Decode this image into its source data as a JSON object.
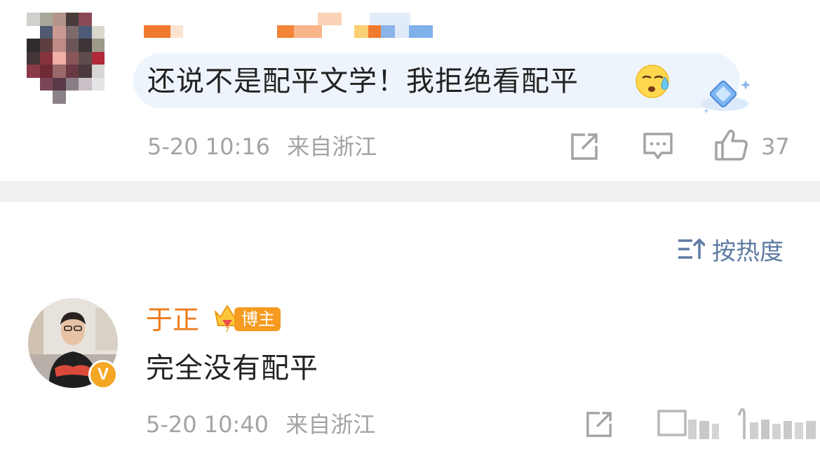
{
  "comments": [
    {
      "author": "",
      "text": "还说不是配平文学！我拒绝看配平",
      "timestamp": "5-20 10:16",
      "location": "来自浙江",
      "likes": "37",
      "emoji": "sleepy-sweat-emoji"
    },
    {
      "author": "于正",
      "badge": "博主",
      "text": "完全没有配平",
      "timestamp": "5-20 10:40",
      "location": "来自浙江"
    }
  ],
  "sort": {
    "label": "按热度"
  },
  "colors": {
    "bubble": "#eef4fb",
    "meta_gray": "#a3a3a3",
    "author_orange": "#ef7a1a",
    "sort_blue": "#5f7ba4",
    "divider": "#f1f1f1",
    "badge_orange": "#f59b20"
  }
}
